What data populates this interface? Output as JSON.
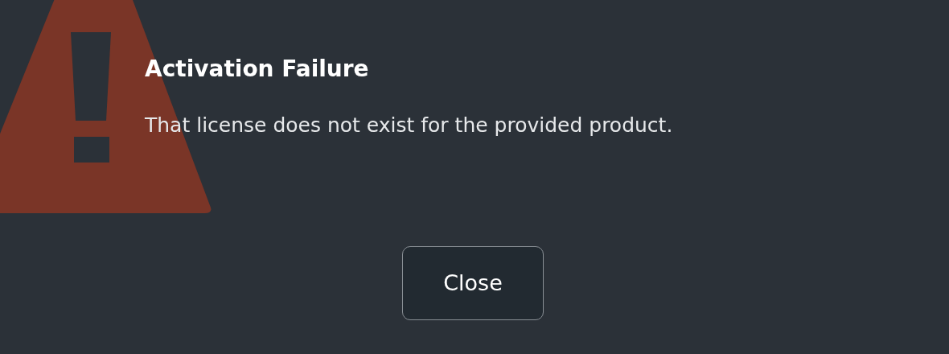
{
  "dialog": {
    "title": "Activation Failure",
    "message": "That license does not exist for the provided product.",
    "buttons": [
      "Close"
    ]
  }
}
